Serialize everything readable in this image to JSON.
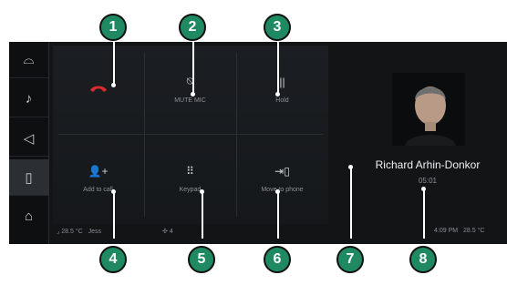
{
  "sidebar": {
    "items": [
      {
        "icon": "car-icon",
        "glyph": "⌓"
      },
      {
        "icon": "music-note-icon",
        "glyph": "♪"
      },
      {
        "icon": "navigation-arrow-icon",
        "glyph": "◁"
      },
      {
        "icon": "phone-icon",
        "glyph": "▯"
      },
      {
        "icon": "home-icon",
        "glyph": "⌂"
      }
    ],
    "active_index": 3
  },
  "controls": {
    "end_call": {
      "icon": "end-call-icon",
      "color": "#d92b2b"
    },
    "mute_mic": {
      "label": "MUTE MIC",
      "icon": "mic-off-icon",
      "glyph": "⍉"
    },
    "hold": {
      "label": "Hold",
      "icon": "pause-icon",
      "glyph": "||"
    },
    "add_to_call": {
      "label": "Add to call",
      "icon": "add-person-icon",
      "glyph": "👤+"
    },
    "keypad": {
      "label": "Keypad",
      "icon": "keypad-icon",
      "glyph": "⠿"
    },
    "move_to_phone": {
      "label": "Move to phone",
      "icon": "transfer-phone-icon",
      "glyph": "⇥▯"
    }
  },
  "call": {
    "caller_name": "Richard Arhin-Donkor",
    "duration": "05:01"
  },
  "status_bar": {
    "left_temp": "28.5 °C",
    "left_user": "Jess",
    "fan_level": "4",
    "time": "4:09 PM",
    "right_temp": "28.5 °C"
  },
  "callouts": [
    "1",
    "2",
    "3",
    "4",
    "5",
    "6",
    "7",
    "8"
  ],
  "colors": {
    "badge": "#1f8a62",
    "end_call": "#d92b2b",
    "background": "#121416"
  }
}
